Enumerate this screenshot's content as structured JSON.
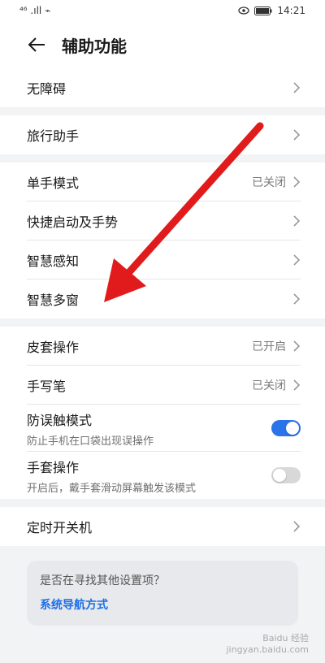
{
  "status": {
    "left": "⁴⁶ .ıll ⌁",
    "time": "14:21"
  },
  "header": {
    "title": "辅助功能"
  },
  "sections": {
    "s1": "无障碍",
    "s2": "旅行助手",
    "s3": [
      {
        "label": "单手模式",
        "value": "已关闭"
      },
      {
        "label": "快捷启动及手势",
        "value": ""
      },
      {
        "label": "智慧感知",
        "value": ""
      },
      {
        "label": "智慧多窗",
        "value": ""
      }
    ],
    "s4": {
      "cover": {
        "label": "皮套操作",
        "value": "已开启"
      },
      "pen": {
        "label": "手写笔",
        "value": "已关闭"
      },
      "antitouch": {
        "label": "防误触模式",
        "sub": "防止手机在口袋出现误操作"
      },
      "glove": {
        "label": "手套操作",
        "sub": "开启后，戴手套滑动屏幕触发该模式"
      }
    },
    "s5": "定时开关机"
  },
  "card": {
    "question": "是否在寻找其他设置项？",
    "link": "系统导航方式"
  },
  "watermark": {
    "line1": "Baidu 经验",
    "line2": "jingyan.baidu.com"
  },
  "colors": {
    "accent": "#2a73e8",
    "arrow": "#e11b1b"
  }
}
